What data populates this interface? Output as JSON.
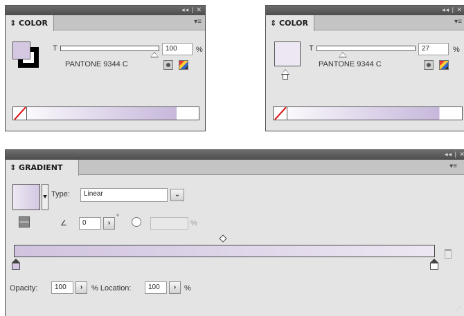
{
  "color_panel_1": {
    "title": "COLOR",
    "tint_label": "T",
    "tint_value": "100",
    "percent": "%",
    "color_name": "PANTONE 9344 C",
    "tint_fraction": 1.0
  },
  "color_panel_2": {
    "title": "COLOR",
    "tint_label": "T",
    "tint_value": "27",
    "percent": "%",
    "color_name": "PANTONE 9344 C",
    "tint_fraction": 0.27
  },
  "gradient_panel": {
    "title": "GRADIENT",
    "type_label": "Type:",
    "type_value": "Linear",
    "angle_value": "0",
    "degree": "°",
    "aspect_percent": "%",
    "opacity_label": "Opacity:",
    "opacity_value": "100",
    "location_label": "% Location:",
    "location_value": "100",
    "location_percent": "%"
  },
  "colors": {
    "swatch": "#d4c8e2",
    "swatch_light": "#ece7f2",
    "panel_bg": "#e4e4e4",
    "titlebar": "#555555"
  },
  "icons": {
    "collapse": "double-chevron-left-icon",
    "close": "close-icon",
    "menu": "panel-menu-icon",
    "reverse": "reverse-gradient-icon",
    "angle": "angle-icon",
    "aspect": "aspect-ratio-icon",
    "trash": "trash-icon",
    "none": "none-swatch-icon"
  }
}
